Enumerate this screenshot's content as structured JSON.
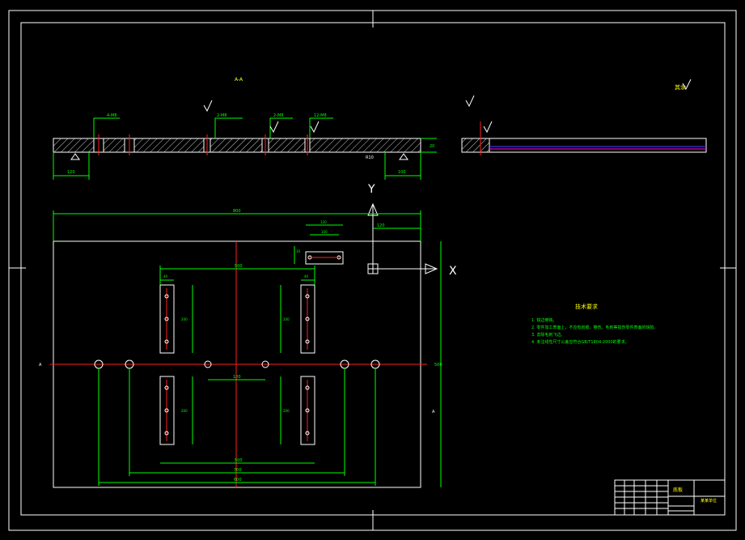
{
  "drawing": {
    "section_label": "A-A",
    "roughness_note": "其余",
    "axis_y_label": "Y",
    "axis_x_label": "X",
    "section_mark_a": "A",
    "section_ref_a": "A",
    "tech_requirements": {
      "title": "技术要求",
      "items": [
        "1. 锐边倒钝。",
        "2. 零件加工表面上，不应有划痕、擦伤、毛刺等损伤零件表面的缺陷。",
        "3. 去除毛刺飞边。",
        "4. 未注线性尺寸公差应符合GB/T1804-2000的要求。"
      ]
    },
    "title_block": {
      "part_name": "底板",
      "company": "某某单位"
    },
    "dimensions": {
      "overall_width": "800",
      "overall_height": "500",
      "slot_span": "500",
      "hole_span_inner": "700",
      "hole_span_outer": "600",
      "center_span": "100",
      "offset_right": "120",
      "slot_top_width": "40",
      "slot_length": "200",
      "slot_pitch": "250",
      "small_slot_w": "120",
      "small_slot_h": "100",
      "small_slot_off": "10",
      "thickness": "20",
      "sec_left": "120",
      "sec_right": "100",
      "sec_hole_1": "4-M8",
      "sec_hole_2": "2-M8",
      "sec_hole_3": "12-M8",
      "r_note": "R10",
      "rough_val": "3.2"
    },
    "colors": {
      "background": "#000000",
      "frame": "#ffffff",
      "dimension": "#00ff00",
      "centerline": "#ff2020",
      "text_note": "#ffff00",
      "hatch": "#ffffff",
      "blue_line": "#4444ff",
      "magenta_line": "#ff00ff"
    }
  }
}
